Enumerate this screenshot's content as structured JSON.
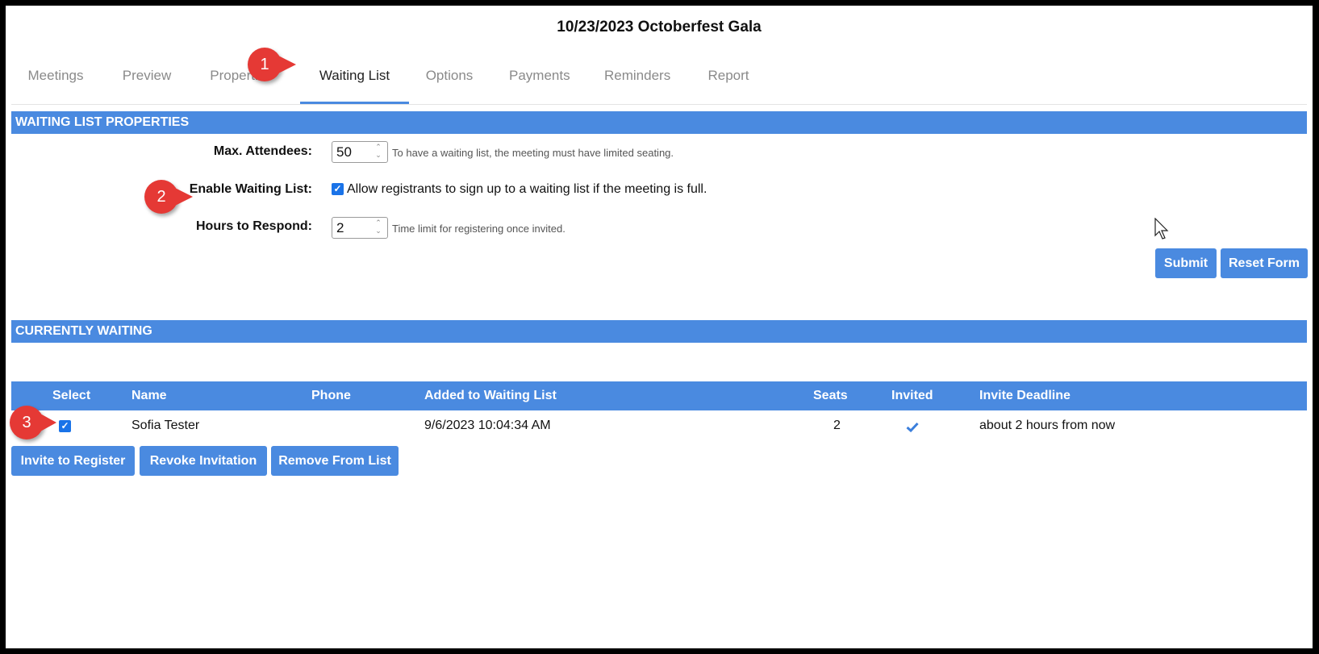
{
  "page": {
    "title": "10/23/2023 Octoberfest Gala"
  },
  "tabs": [
    "Meetings",
    "Preview",
    "Properties",
    "Waiting List",
    "Options",
    "Payments",
    "Reminders",
    "Report"
  ],
  "waiting_list_properties": {
    "header": "WAITING LIST PROPERTIES",
    "max_attendees_label": "Max. Attendees:",
    "max_attendees_value": "50",
    "max_attendees_hint": "To have a waiting list, the meeting must have limited seating.",
    "enable_label": "Enable Waiting List:",
    "enable_checked": true,
    "enable_text": "Allow registrants to sign up to a waiting list if the meeting is full.",
    "hours_label": "Hours to Respond:",
    "hours_value": "2",
    "hours_hint": "Time limit for registering once invited.",
    "submit_label": "Submit",
    "reset_label": "Reset Form"
  },
  "currently_waiting": {
    "header": "CURRENTLY WAITING",
    "columns": {
      "select": "Select",
      "name": "Name",
      "phone": "Phone",
      "added": "Added to Waiting List",
      "seats": "Seats",
      "invited": "Invited",
      "deadline": "Invite Deadline"
    },
    "rows": [
      {
        "selected": true,
        "name": "Sofia Tester",
        "phone": "",
        "added": "9/6/2023 10:04:34 AM",
        "seats": "2",
        "invited": true,
        "deadline": "about 2 hours from now"
      }
    ],
    "buttons": {
      "invite": "Invite to Register",
      "revoke": "Revoke Invitation",
      "remove": "Remove From List"
    }
  },
  "callouts": [
    "1",
    "2",
    "3"
  ],
  "colors": {
    "accent": "#4a8ae0",
    "callout": "#e53935",
    "checkbox": "#1a73e8"
  },
  "icons": {
    "invited": "checkmark-icon",
    "spinner": "spinner-arrows-icon",
    "cursor": "mouse-pointer-icon"
  }
}
